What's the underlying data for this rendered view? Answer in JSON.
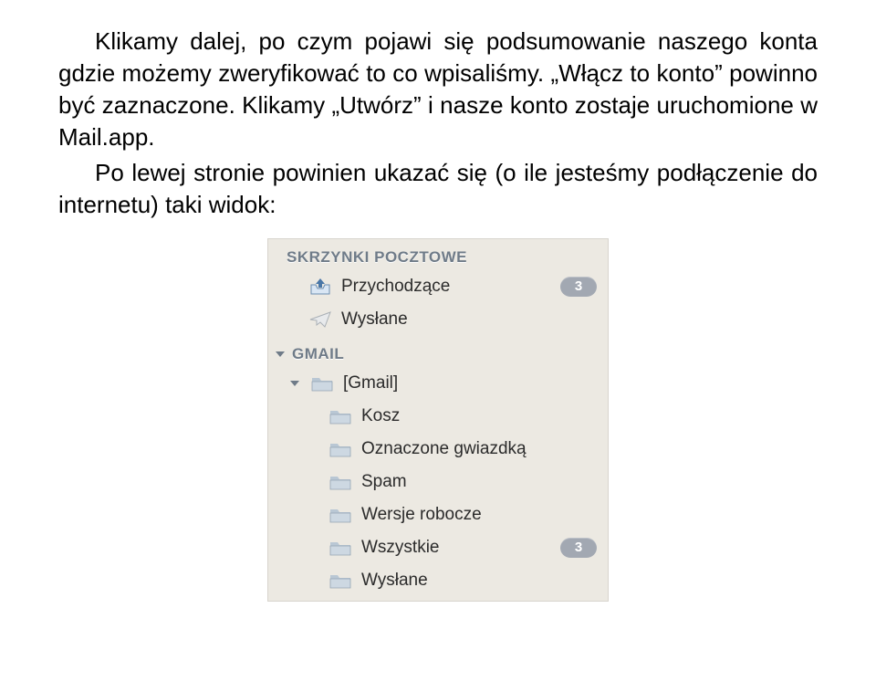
{
  "prose": {
    "p1": "Klikamy dalej, po czym pojawi się podsumowanie naszego konta gdzie możemy zweryfikować to co wpisaliśmy. „Włącz to konto” powinno być zaznaczone. Klikamy „Utwórz” i nasze konto zostaje uruchomione w Mail.app.",
    "p2": "Po lewej stronie powinien ukazać się (o ile jesteśmy podłączenie do internetu) taki widok:"
  },
  "sidebar": {
    "sections": {
      "mailboxes": {
        "header": "SKRZYNKI POCZTOWE",
        "items": [
          {
            "name": "inbox",
            "label": "Przychodzące",
            "icon": "inbox-icon",
            "badge": "3"
          },
          {
            "name": "sent",
            "label": "Wysłane",
            "icon": "paper-plane-icon",
            "badge": null
          }
        ]
      },
      "gmail": {
        "header": "GMAIL",
        "parent": {
          "label": "[Gmail]",
          "icon": "folder-icon"
        },
        "items": [
          {
            "name": "trash",
            "label": "Kosz",
            "icon": "folder-icon",
            "badge": null
          },
          {
            "name": "starred",
            "label": "Oznaczone gwiazdką",
            "icon": "folder-icon",
            "badge": null
          },
          {
            "name": "spam",
            "label": "Spam",
            "icon": "folder-icon",
            "badge": null
          },
          {
            "name": "drafts",
            "label": "Wersje robocze",
            "icon": "folder-icon",
            "badge": null
          },
          {
            "name": "all",
            "label": "Wszystkie",
            "icon": "folder-icon",
            "badge": "3"
          },
          {
            "name": "sent2",
            "label": "Wysłane",
            "icon": "folder-icon",
            "badge": null
          }
        ]
      }
    }
  }
}
